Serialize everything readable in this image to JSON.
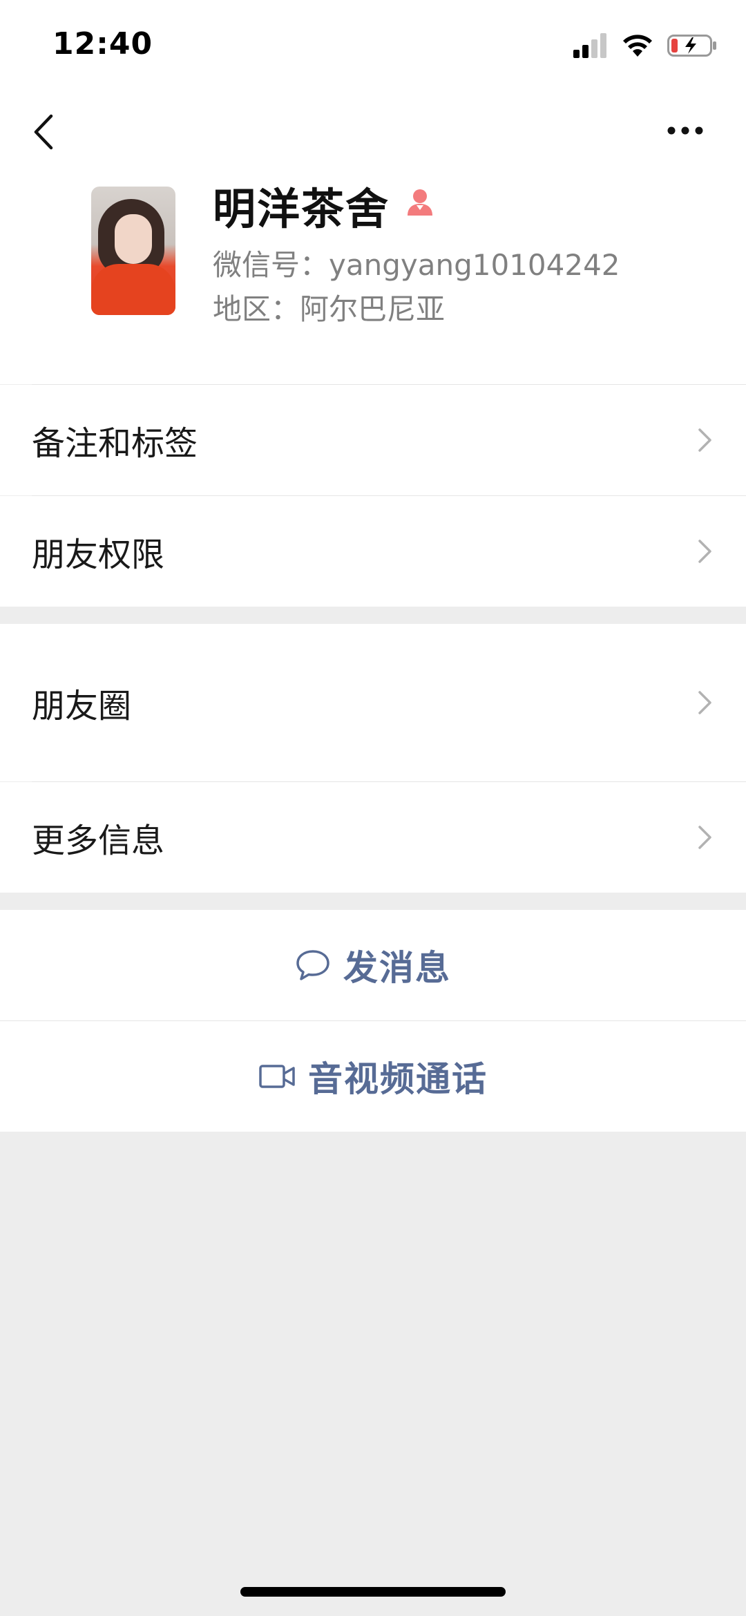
{
  "status_bar": {
    "time": "12:40",
    "icons": [
      "signal-icon",
      "wifi-icon",
      "battery-charging-icon"
    ],
    "battery_color": "#e64340"
  },
  "nav": {
    "back_icon": "chevron-left-icon",
    "more_icon": "more-dots-icon"
  },
  "profile": {
    "name": "明洋茶舍",
    "gender_icon": "female-icon",
    "gender_color": "#f37b7d",
    "wechat_id_label": "微信号：",
    "wechat_id": "yangyang10104242",
    "region_label": "地区：",
    "region": "阿尔巴尼亚"
  },
  "cells_group1": [
    {
      "label": "备注和标签"
    },
    {
      "label": "朋友权限"
    }
  ],
  "cells_group2": [
    {
      "label": "朋友圈"
    },
    {
      "label": "更多信息"
    }
  ],
  "actions": [
    {
      "label": "发消息",
      "icon": "chat-bubble-icon"
    },
    {
      "label": "音视频通话",
      "icon": "video-camera-icon"
    }
  ],
  "colors": {
    "link_blue": "#576b95",
    "background": "#ededed"
  }
}
